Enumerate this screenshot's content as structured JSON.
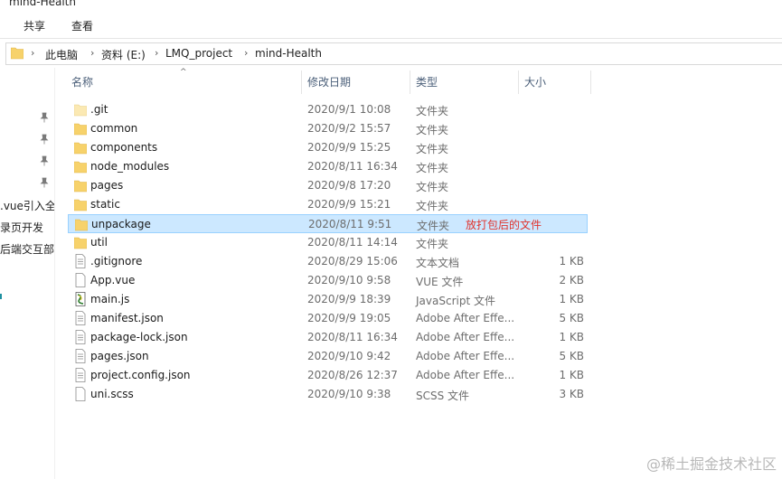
{
  "window": {
    "title": "mind-Health"
  },
  "ribbon": {
    "tabs": [
      "共享",
      "查看"
    ]
  },
  "address": {
    "crumbs": [
      "此电脑",
      "资料 (E:)",
      "LMQ_project",
      "mind-Health"
    ]
  },
  "nav": {
    "items": [
      ".vue引入全",
      "录页开发",
      "后端交互部"
    ]
  },
  "columns": {
    "name": "名称",
    "date": "修改日期",
    "type": "类型",
    "size": "大小"
  },
  "files": [
    {
      "name": ".git",
      "date": "2020/9/1 10:08",
      "type": "文件夹",
      "size": "",
      "icon": "folder-icon",
      "icon_variant": "light"
    },
    {
      "name": "common",
      "date": "2020/9/2 15:57",
      "type": "文件夹",
      "size": "",
      "icon": "folder-icon"
    },
    {
      "name": "components",
      "date": "2020/9/9 15:25",
      "type": "文件夹",
      "size": "",
      "icon": "folder-icon"
    },
    {
      "name": "node_modules",
      "date": "2020/8/11 16:34",
      "type": "文件夹",
      "size": "",
      "icon": "folder-icon"
    },
    {
      "name": "pages",
      "date": "2020/9/8 17:20",
      "type": "文件夹",
      "size": "",
      "icon": "folder-icon"
    },
    {
      "name": "static",
      "date": "2020/9/9 15:21",
      "type": "文件夹",
      "size": "",
      "icon": "folder-icon"
    },
    {
      "name": "unpackage",
      "date": "2020/8/11 9:51",
      "type": "文件夹",
      "size": "",
      "icon": "folder-icon",
      "selected": true,
      "annotation": "放打包后的文件"
    },
    {
      "name": "util",
      "date": "2020/8/11 14:14",
      "type": "文件夹",
      "size": "",
      "icon": "folder-icon"
    },
    {
      "name": ".gitignore",
      "date": "2020/8/29 15:06",
      "type": "文本文档",
      "size": "1 KB",
      "icon": "document-icon"
    },
    {
      "name": "App.vue",
      "date": "2020/9/10 9:58",
      "type": "VUE 文件",
      "size": "2 KB",
      "icon": "blank-file-icon"
    },
    {
      "name": "main.js",
      "date": "2020/9/9 18:39",
      "type": "JavaScript 文件",
      "size": "1 KB",
      "icon": "script-file-icon"
    },
    {
      "name": "manifest.json",
      "date": "2020/9/9 19:05",
      "type": "Adobe After Effe...",
      "size": "5 KB",
      "icon": "document-icon"
    },
    {
      "name": "package-lock.json",
      "date": "2020/8/11 16:34",
      "type": "Adobe After Effe...",
      "size": "1 KB",
      "icon": "document-icon"
    },
    {
      "name": "pages.json",
      "date": "2020/9/10 9:42",
      "type": "Adobe After Effe...",
      "size": "5 KB",
      "icon": "document-icon"
    },
    {
      "name": "project.config.json",
      "date": "2020/8/26 12:37",
      "type": "Adobe After Effe...",
      "size": "1 KB",
      "icon": "document-icon"
    },
    {
      "name": "uni.scss",
      "date": "2020/9/10 9:38",
      "type": "SCSS 文件",
      "size": "3 KB",
      "icon": "blank-file-icon"
    }
  ],
  "colors": {
    "selection_bg": "#cce8ff",
    "selection_border": "#99d1ff",
    "folder": "#f7d26b",
    "annotation": "#e0322c",
    "header_text": "#4c607a"
  },
  "watermark": "@稀土掘金技术社区"
}
